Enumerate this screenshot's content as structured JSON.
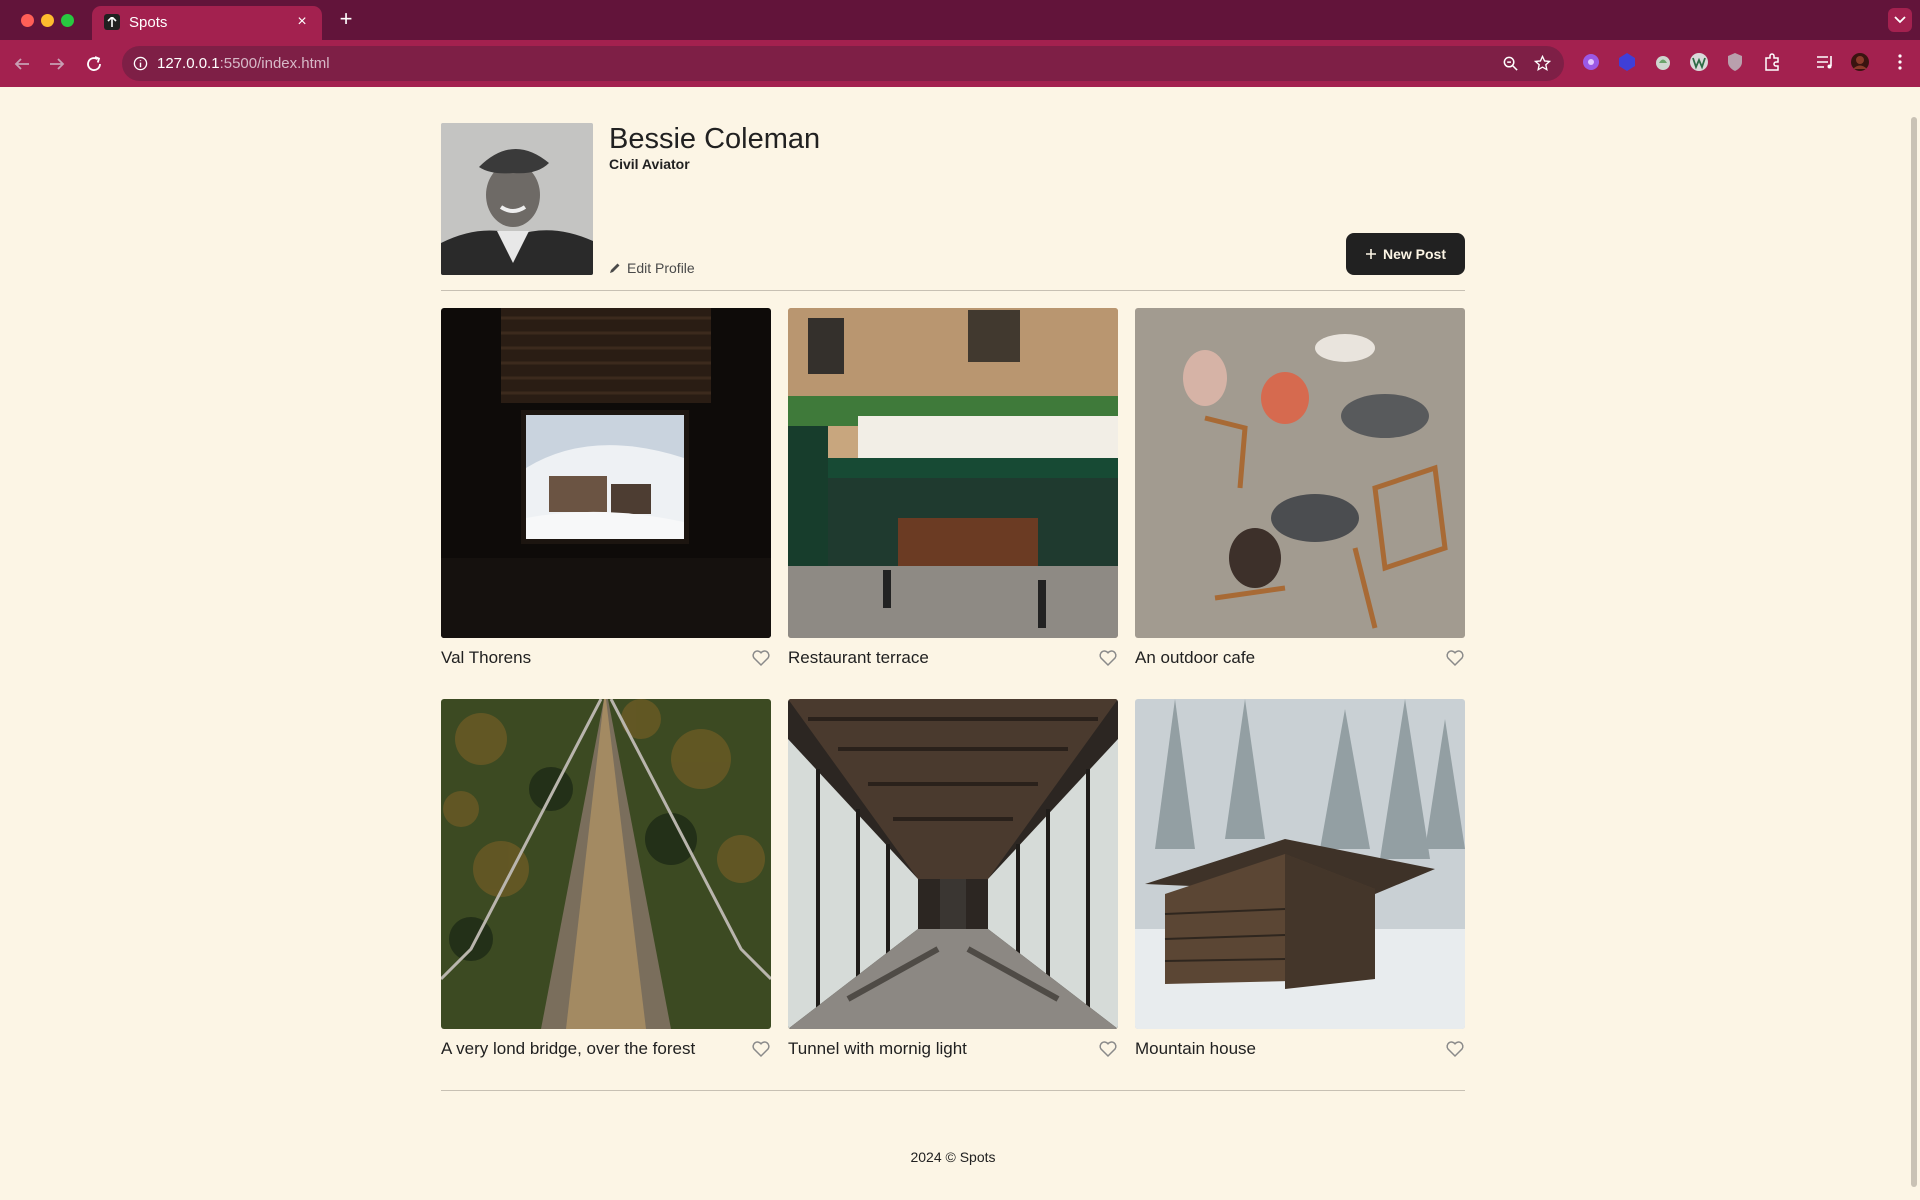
{
  "browser": {
    "tab_title": "Spots",
    "tab_close": "×",
    "new_tab": "+",
    "url_host": "127.0.0.1",
    "url_path": ":5500/index.html"
  },
  "profile": {
    "name": "Bessie Coleman",
    "description": "Civil Aviator",
    "edit_label": "Edit Profile",
    "new_post_label": "New Post"
  },
  "cards": [
    {
      "title": "Val Thorens"
    },
    {
      "title": "Restaurant terrace"
    },
    {
      "title": "An outdoor cafe"
    },
    {
      "title": "A very lond bridge, over the forest"
    },
    {
      "title": "Tunnel with mornig light"
    },
    {
      "title": "Mountain house"
    }
  ],
  "footer": {
    "text": "2024 © Spots"
  },
  "colors": {
    "page_background": "#fcf5e5",
    "text": "#212121",
    "browser_frame": "#62143a",
    "browser_toolbar": "#a3214f"
  }
}
